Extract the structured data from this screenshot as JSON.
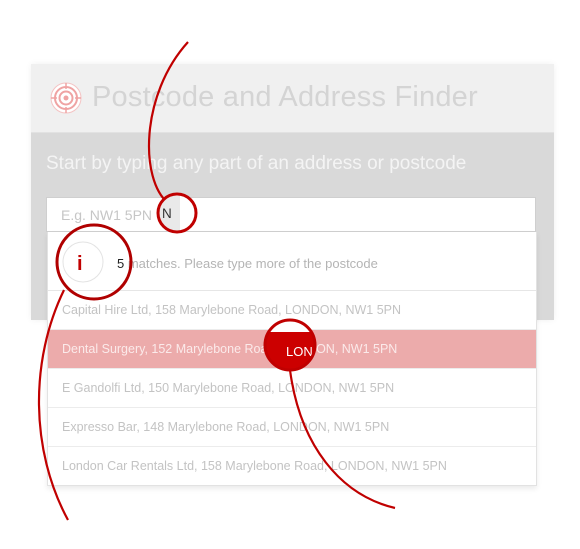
{
  "app": {
    "title": "Postcode and Address Finder",
    "accent_color": "#c00000",
    "logo_icon": "target-icon"
  },
  "search": {
    "prompt": "Start by typing any part of an address or postcode",
    "placeholder": "E.g. NW1 5PN",
    "magnified_text": "N"
  },
  "status": {
    "icon": "info-icon",
    "icon_label": "i",
    "count": "5",
    "message": " matches. Please type more of the postcode",
    "magnified_count": "5"
  },
  "results": [
    {
      "text": "Capital Hire Ltd, 158 Marylebone Road, LONDON, NW1 5PN",
      "selected": false
    },
    {
      "text": "Dental Surgery, 152 Marylebone Road, LONDON, NW1 5PN",
      "selected": true
    },
    {
      "text": "E Gandolfi Ltd, 150 Marylebone Road, LONDON, NW1 5PN",
      "selected": false
    },
    {
      "text": "Expresso Bar, 148 Marylebone Road, LONDON, NW1 5PN",
      "selected": false
    },
    {
      "text": "London Car Rentals Ltd, 158 Marylebone Road, LONDON, NW1 5PN",
      "selected": false
    }
  ],
  "highlight": {
    "magnified_text": "LON",
    "selected_color": "#ecabab"
  }
}
